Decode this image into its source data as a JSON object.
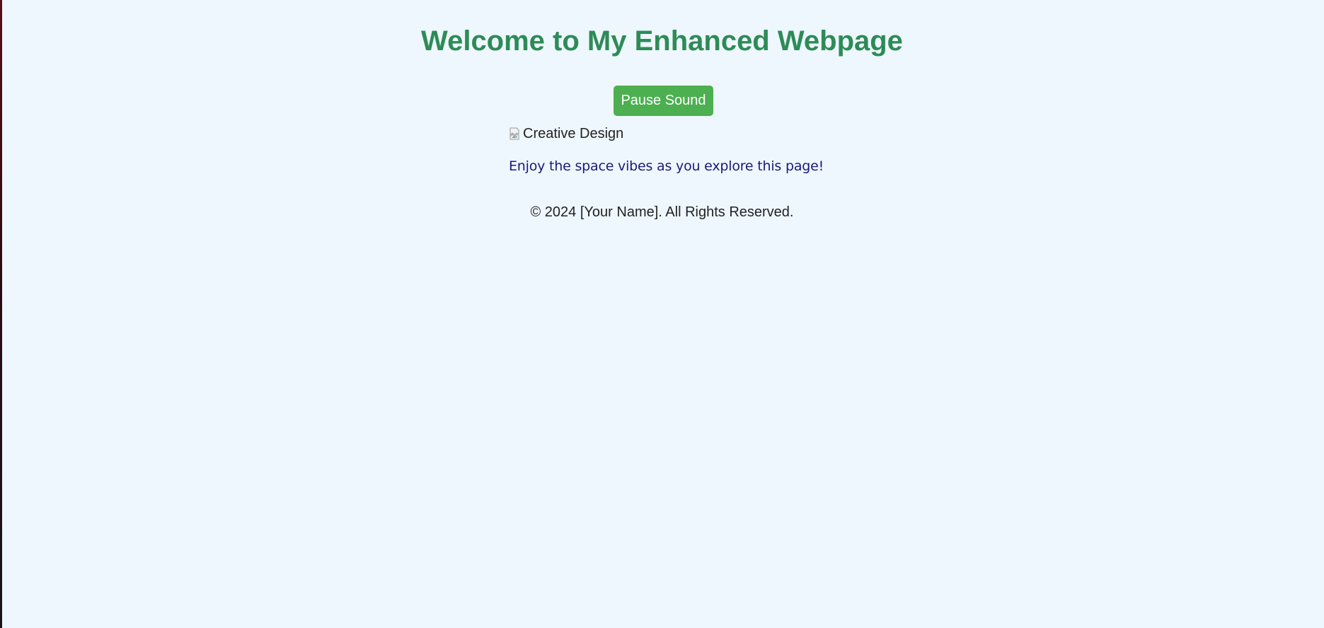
{
  "page": {
    "title": "Welcome to My Enhanced Webpage",
    "sound_button_label": "Pause Sound",
    "image": {
      "alt": "Creative Design",
      "icon": "broken-image-icon"
    },
    "tagline": "Enjoy the space vibes as you explore this page!",
    "footer": "© 2024 [Your Name]. All Rights Reserved."
  },
  "colors": {
    "background": "#eef7fd",
    "title": "#2e8b57",
    "button_bg": "#4caf50",
    "button_text": "#ffffff",
    "tagline": "#1a1a7a",
    "body_text": "#222222"
  }
}
